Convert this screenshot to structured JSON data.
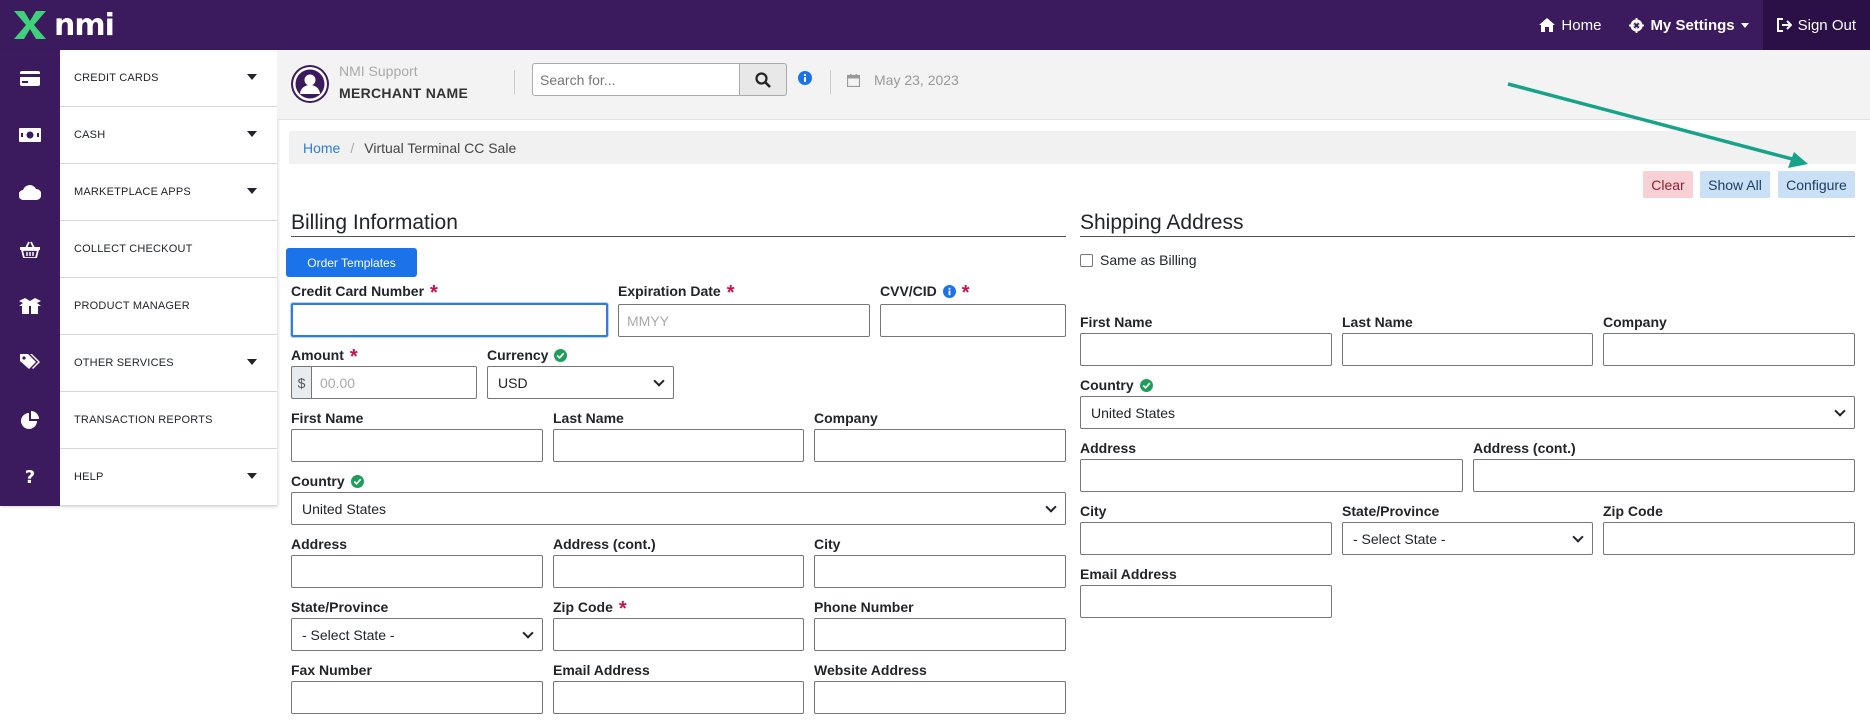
{
  "brand": {
    "logo_text": "nmi"
  },
  "topnav": {
    "home": "Home",
    "settings": "My Settings",
    "signout": "Sign Out"
  },
  "sidebar": {
    "items": [
      {
        "label": "CREDIT CARDS",
        "icon": "credit-card-icon",
        "has_caret": true
      },
      {
        "label": "CASH",
        "icon": "cash-icon",
        "has_caret": true
      },
      {
        "label": "MARKETPLACE APPS",
        "icon": "cloud-icon",
        "has_caret": true
      },
      {
        "label": "COLLECT CHECKOUT",
        "icon": "basket-icon",
        "has_caret": false
      },
      {
        "label": "PRODUCT MANAGER",
        "icon": "boxes-icon",
        "has_caret": false
      },
      {
        "label": "OTHER SERVICES",
        "icon": "tags-icon",
        "has_caret": true
      },
      {
        "label": "TRANSACTION REPORTS",
        "icon": "pie-chart-icon",
        "has_caret": false
      },
      {
        "label": "HELP",
        "icon": "question-icon",
        "has_caret": true
      }
    ]
  },
  "merchant": {
    "support": "NMI Support",
    "name": "MERCHANT NAME"
  },
  "search": {
    "placeholder": "Search for..."
  },
  "date": "May 23, 2023",
  "breadcrumb": {
    "home": "Home",
    "sep": "/",
    "current": "Virtual Terminal CC Sale"
  },
  "actions": {
    "clear": "Clear",
    "show_all": "Show All",
    "configure": "Configure"
  },
  "billing": {
    "title": "Billing Information",
    "order_templates": "Order Templates",
    "cc_number": "Credit Card Number",
    "expiration": "Expiration Date",
    "expiration_placeholder": "MMYY",
    "cvv": "CVV/CID",
    "amount": "Amount",
    "amount_prefix": "$",
    "amount_placeholder": "00.00",
    "currency": "Currency",
    "currency_value": "USD",
    "first_name": "First Name",
    "last_name": "Last Name",
    "company": "Company",
    "country": "Country",
    "country_value": "United States",
    "address": "Address",
    "address_cont": "Address (cont.)",
    "city": "City",
    "state": "State/Province",
    "state_value": "- Select State -",
    "zip": "Zip Code",
    "phone": "Phone Number",
    "fax": "Fax Number",
    "email": "Email Address",
    "website": "Website Address"
  },
  "shipping": {
    "title": "Shipping Address",
    "same_as_billing": "Same as Billing",
    "first_name": "First Name",
    "last_name": "Last Name",
    "company": "Company",
    "country": "Country",
    "country_value": "United States",
    "address": "Address",
    "address_cont": "Address (cont.)",
    "city": "City",
    "state": "State/Province",
    "state_value": "- Select State -",
    "zip": "Zip Code",
    "email": "Email Address"
  },
  "colors": {
    "brand_purple": "#3b1b5e",
    "primary_blue": "#1a73e8",
    "required_red": "#c4124a",
    "ok_green": "#1e9e5a",
    "annotation_arrow": "#16a38a"
  }
}
